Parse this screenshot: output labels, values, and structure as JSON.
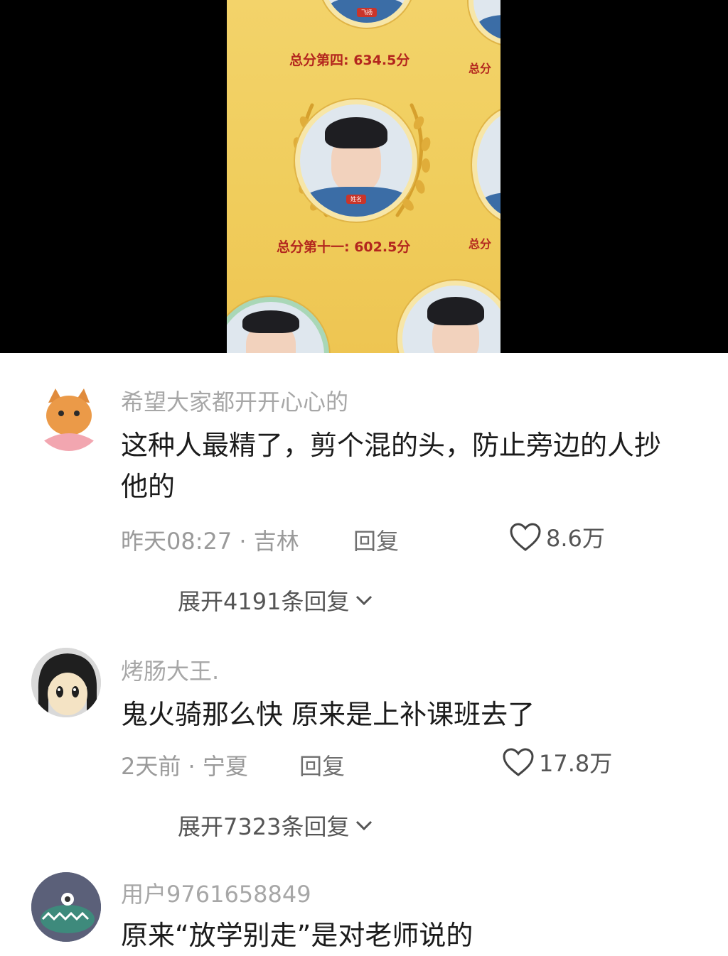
{
  "video": {
    "score_4th": "总分第四: 634.5分",
    "score_11th": "总分第十一: 602.5分",
    "score_partial_top": "总分",
    "score_partial_mid": "总分"
  },
  "comments": [
    {
      "username": "希望大家都开开心心的",
      "content": "这种人最精了，剪个混的头，防止旁边的人抄他的",
      "time": "昨天08:27",
      "location": "吉林",
      "reply_label": "回复",
      "likes": "8.6万",
      "expand_label": "展开4191条回复"
    },
    {
      "username": "烤肠大王.",
      "content": "鬼火骑那么快 原来是上补课班去了",
      "time": "2天前",
      "location": "宁夏",
      "reply_label": "回复",
      "likes": "17.8万",
      "expand_label": "展开7323条回复"
    },
    {
      "username": "用户9761658849",
      "content": "原来“放学别走”是对老师说的"
    }
  ],
  "colors": {
    "board_bg": "#f0cd5c",
    "score_text": "#b3261e",
    "username": "#a7a7a7",
    "content": "#1b1b1b"
  }
}
